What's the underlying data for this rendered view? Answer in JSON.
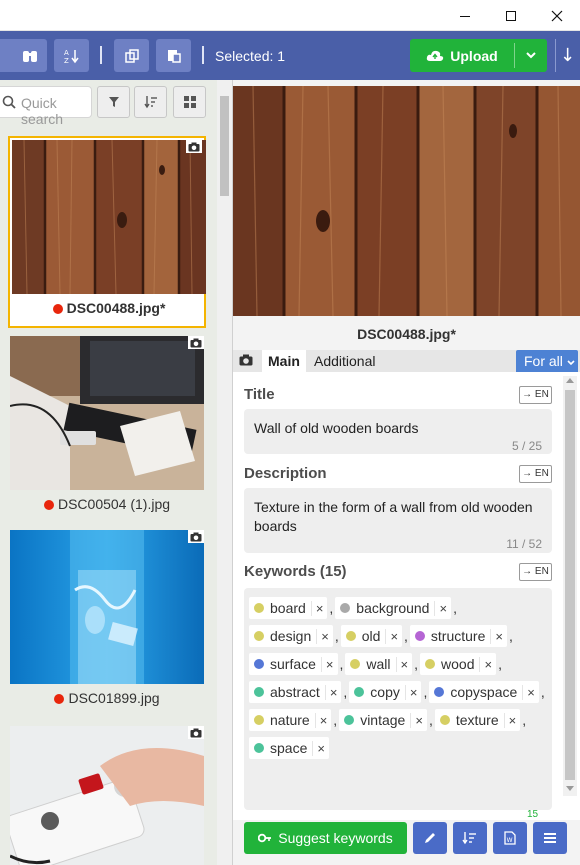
{
  "window": {
    "minimize": "—",
    "maximize": "☐",
    "close": "✕"
  },
  "toolbar": {
    "selected": "Selected: 1",
    "upload": "Upload"
  },
  "left": {
    "search_placeholder": "Quick search",
    "thumbs": [
      {
        "name": "DSC00488.jpg*",
        "selected": true
      },
      {
        "name": "DSC00504 (1).jpg",
        "selected": false
      },
      {
        "name": "DSC01899.jpg",
        "selected": false
      }
    ]
  },
  "right": {
    "filename": "DSC00488.jpg*",
    "tabs": {
      "main": "Main",
      "additional": "Additional",
      "for_all": "For all"
    },
    "title": {
      "label": "Title",
      "translate": "→ EN",
      "value": "Wall of old wooden boards",
      "count": "5 / 25"
    },
    "description": {
      "label": "Description",
      "translate": "→ EN",
      "value": "Texture in the form of a wall from old wooden boards",
      "count": "11 / 52"
    },
    "keywords": {
      "label": "Keywords (15)",
      "translate": "→ EN",
      "count": "15",
      "items": [
        {
          "word": "board",
          "color": "#d6cf63"
        },
        {
          "word": "background",
          "color": "#a9a9a9"
        },
        {
          "word": "design",
          "color": "#d6cf63"
        },
        {
          "word": "old",
          "color": "#d6cf63"
        },
        {
          "word": "structure",
          "color": "#b565d4"
        },
        {
          "word": "surface",
          "color": "#5577d6"
        },
        {
          "word": "wall",
          "color": "#d6cf63"
        },
        {
          "word": "wood",
          "color": "#d6cf63"
        },
        {
          "word": "abstract",
          "color": "#4cc39a"
        },
        {
          "word": "copy",
          "color": "#4cc39a"
        },
        {
          "word": "copyspace",
          "color": "#5577d6"
        },
        {
          "word": "nature",
          "color": "#d6cf63"
        },
        {
          "word": "vintage",
          "color": "#4cc39a"
        },
        {
          "word": "texture",
          "color": "#d6cf63"
        },
        {
          "word": "space",
          "color": "#4cc39a"
        }
      ]
    },
    "suggest": "Suggest keywords"
  },
  "colors": {
    "toolbar": "#4a5fa8",
    "accent_green": "#21b33a",
    "selection": "#f4b400",
    "status_dot": "#e8260c"
  }
}
